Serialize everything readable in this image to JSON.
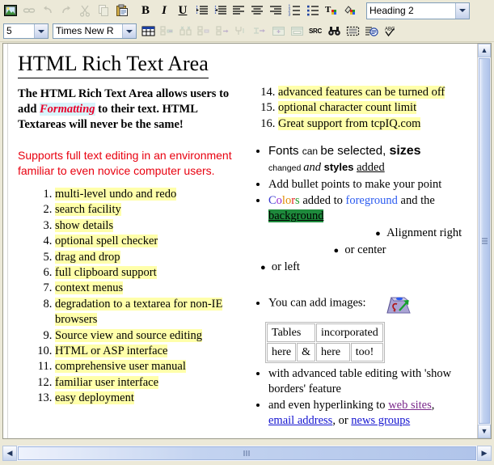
{
  "toolbar_row1": [
    {
      "name": "image-icon",
      "label": "image",
      "disabled": false
    },
    {
      "name": "link-icon",
      "label": "link",
      "disabled": true
    },
    {
      "name": "undo-icon",
      "label": "undo",
      "disabled": true
    },
    {
      "name": "redo-icon",
      "label": "redo",
      "disabled": true
    },
    {
      "name": "cut-icon",
      "label": "cut",
      "disabled": true
    },
    {
      "name": "copy-icon",
      "label": "copy",
      "disabled": true
    },
    {
      "name": "paste-icon",
      "label": "paste",
      "disabled": false
    },
    {
      "name": "bold-icon",
      "label": "B",
      "disabled": false
    },
    {
      "name": "italic-icon",
      "label": "I",
      "disabled": false
    },
    {
      "name": "underline-icon",
      "label": "U",
      "disabled": false
    },
    {
      "name": "indent-increase-icon",
      "label": "indent",
      "disabled": false
    },
    {
      "name": "indent-decrease-icon",
      "label": "outdent",
      "disabled": false
    },
    {
      "name": "align-left-icon",
      "label": "align left",
      "disabled": false
    },
    {
      "name": "align-center-icon",
      "label": "align center",
      "disabled": false
    },
    {
      "name": "align-right-icon",
      "label": "align right",
      "disabled": false
    },
    {
      "name": "ordered-list-icon",
      "label": "numbered list",
      "disabled": false
    },
    {
      "name": "unordered-list-icon",
      "label": "bullet list",
      "disabled": false
    },
    {
      "name": "font-color-icon",
      "label": "text color",
      "disabled": false
    },
    {
      "name": "background-color-icon",
      "label": "highlight color",
      "disabled": false
    }
  ],
  "toolbar_row2": [
    {
      "name": "insert-table-icon",
      "label": "insert table",
      "disabled": false
    },
    {
      "name": "insert-column-left-icon",
      "label": "insert column left",
      "disabled": true
    },
    {
      "name": "delete-column-icon",
      "label": "delete column",
      "disabled": true
    },
    {
      "name": "insert-row-above-icon",
      "label": "insert row above",
      "disabled": true
    },
    {
      "name": "insert-row-below-icon",
      "label": "insert row below",
      "disabled": true
    },
    {
      "name": "delete-row-icon",
      "label": "delete row",
      "disabled": true
    },
    {
      "name": "merge-cells-icon",
      "label": "merge cells",
      "disabled": true
    },
    {
      "name": "cell-properties-icon",
      "label": "cell properties",
      "disabled": true
    },
    {
      "name": "table-properties-icon",
      "label": "table properties",
      "disabled": true
    },
    {
      "name": "source-view-icon",
      "label": "SRC",
      "disabled": false
    },
    {
      "name": "find-icon",
      "label": "find",
      "disabled": false
    },
    {
      "name": "show-borders-icon",
      "label": "show borders",
      "disabled": false
    },
    {
      "name": "character-count-icon",
      "label": "character count",
      "disabled": false
    },
    {
      "name": "spell-check-icon",
      "label": "spell check",
      "disabled": false
    }
  ],
  "selects": {
    "style": {
      "value": "Heading 2",
      "name": "style-select"
    },
    "size": {
      "value": "5",
      "name": "font-size-select"
    },
    "font": {
      "value": "Times New R",
      "name": "font-family-select"
    }
  },
  "document": {
    "title": "HTML Rich Text Area",
    "intro": {
      "part1": "The HTML Rich Text Area allows users to add ",
      "formatted_word": "Formatting",
      "part2": " to their text. HTML Textareas will never be the same!"
    },
    "red_paragraph": "Supports full text editing in an environment familiar to even novice computer users.",
    "left_list": [
      "multi-level undo and redo",
      "search facility",
      "show details",
      "optional spell checker",
      "drag and drop",
      "full clipboard support",
      "context menus",
      "degradation to a textarea for non-IE browsers",
      "Source view and source editing",
      "HTML or ASP interface",
      "comprehensive user manual",
      "familiar user interface",
      "easy deployment"
    ],
    "right_list_start": 14,
    "right_list": [
      "advanced features can be turned off",
      "optional character count limit",
      "Great support from tcpIQ.com"
    ],
    "bullets": {
      "fonts_line": {
        "a": "Fonts ",
        "b": "can ",
        "c": "be selected, ",
        "d": "sizes",
        "e": "changed ",
        "f": "and ",
        "g": "styles ",
        "h": "added"
      },
      "add_bullet_points": "Add bullet points to make your point",
      "colors_line": {
        "word": "Colors",
        "letters": [
          "C",
          "o",
          "l",
          "o",
          "r",
          "s"
        ],
        "mid": " added to ",
        "foreground": "foreground",
        "tail": " and the ",
        "background": "background"
      },
      "align_right": "Alignment right",
      "align_center": "or center",
      "align_left": "or left",
      "images_line": "You can add images:",
      "table_editing": "with advanced table editing with 'show borders' feature",
      "hyperlinking": {
        "pre": "and even hyperlinking to ",
        "link1": "web sites",
        "mid1": ", ",
        "link2": "email address",
        "mid2": ", or ",
        "link3": "news groups"
      }
    },
    "table": {
      "row1": [
        "Tables",
        "incorporated"
      ],
      "row2": [
        "here",
        "&",
        "here",
        "too!"
      ]
    }
  },
  "colors": {
    "highlight_yellow": "#ffffaa",
    "highlight_cyan": "#d8f4fb",
    "highlight_green": "#1e8a3c",
    "red_text": "#e8000f",
    "formatting_red": "#e8002a",
    "link_blue": "#1414d0",
    "link_visited": "#7b2a8c"
  },
  "scrollbars": {
    "vertical": {
      "up": "▲",
      "down": "▼"
    },
    "horizontal": {
      "left": "◀",
      "right": "▶"
    }
  }
}
